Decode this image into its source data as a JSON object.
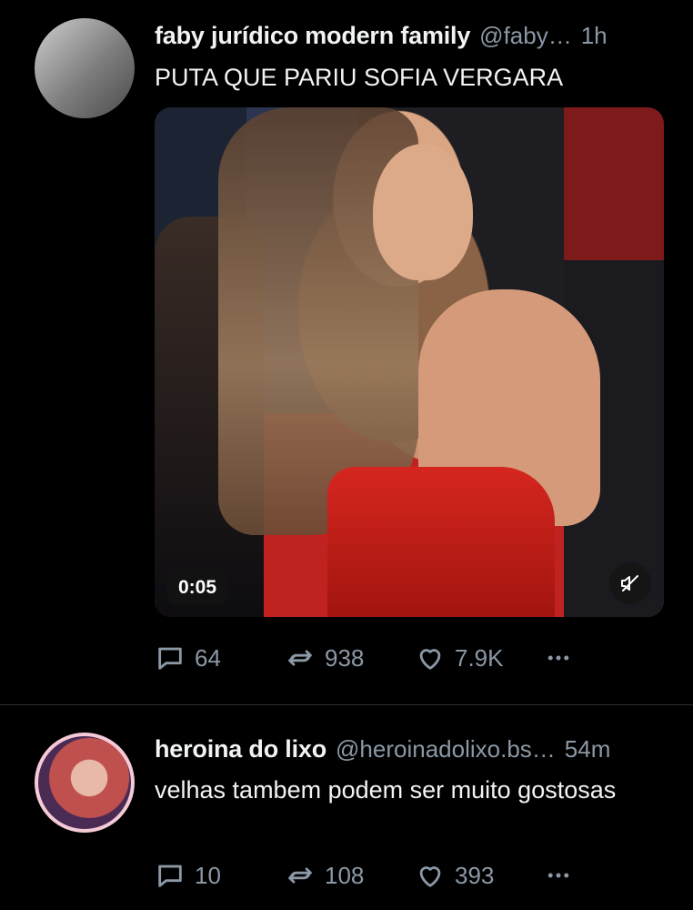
{
  "posts": [
    {
      "author": "faby jurídico modern family",
      "handle": "@faby…",
      "time": "1h",
      "text": "PUTA QUE PARIU SOFIA VERGARA",
      "video": {
        "duration": "0:05",
        "muted": true
      },
      "stats": {
        "replies": "64",
        "reposts": "938",
        "likes": "7.9K"
      }
    },
    {
      "author": "heroina do lixo",
      "handle": "@heroinadolixo.bs…",
      "time": "54m",
      "text": "velhas tambem podem ser muito gostosas",
      "stats": {
        "replies": "10",
        "reposts": "108",
        "likes": "393"
      }
    }
  ],
  "icons": {
    "reply": "speech-bubble-icon",
    "repost": "repost-arrows-icon",
    "like": "heart-icon",
    "more": "ellipsis-icon",
    "mute": "speaker-muted-icon"
  },
  "colors": {
    "background": "#000000",
    "text": "#f1f3f4",
    "muted": "#8b98a5",
    "divider": "#2a2f35"
  }
}
